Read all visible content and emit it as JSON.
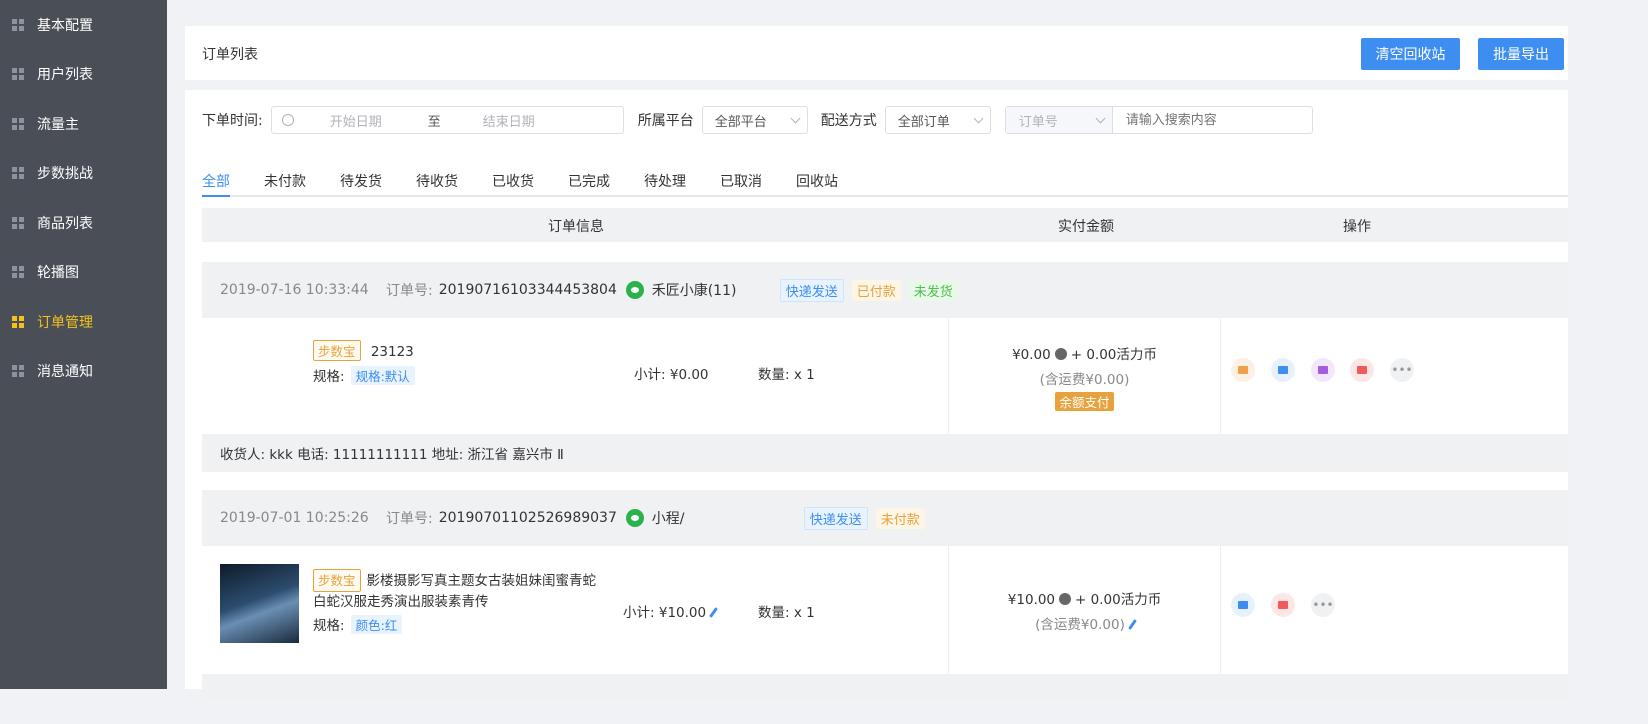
{
  "sidebar": {
    "items": [
      {
        "label": "基本配置",
        "active": false
      },
      {
        "label": "用户列表",
        "active": false
      },
      {
        "label": "流量主",
        "active": false
      },
      {
        "label": "步数挑战",
        "active": false
      },
      {
        "label": "商品列表",
        "active": false
      },
      {
        "label": "轮播图",
        "active": false
      },
      {
        "label": "订单管理",
        "active": true
      },
      {
        "label": "消息通知",
        "active": false
      }
    ]
  },
  "header": {
    "title": "订单列表",
    "clear_recycle_label": "清空回收站",
    "batch_export_label": "批量导出"
  },
  "filters": {
    "order_time_label": "下单时间:",
    "start_date_placeholder": "开始日期",
    "range_separator": "至",
    "end_date_placeholder": "结束日期",
    "platform_label": "所属平台",
    "platform_value": "全部平台",
    "delivery_label": "配送方式",
    "delivery_value": "全部订单",
    "search_field_value": "订单号",
    "search_placeholder": "请输入搜索内容"
  },
  "tabs": [
    {
      "label": "全部",
      "active": true
    },
    {
      "label": "未付款",
      "active": false
    },
    {
      "label": "待发货",
      "active": false
    },
    {
      "label": "待收货",
      "active": false
    },
    {
      "label": "已收货",
      "active": false
    },
    {
      "label": "已完成",
      "active": false
    },
    {
      "label": "待处理",
      "active": false
    },
    {
      "label": "已取消",
      "active": false
    },
    {
      "label": "回收站",
      "active": false
    }
  ],
  "table": {
    "col_order_info": "订单信息",
    "col_amount": "实付金额",
    "col_ops": "操作"
  },
  "orders": [
    {
      "datetime": "2019-07-16 10:33:44",
      "order_no_label": "订单号:",
      "order_no": "20190716103344453804",
      "shop": "禾匠小康(11)",
      "tags": [
        "快递发送",
        "已付款",
        "未发货"
      ],
      "product_badge": "步数宝",
      "product_name": "23123",
      "spec_label": "规格:",
      "spec_value": "规格:默认",
      "subtotal_label": "小计:",
      "subtotal": "¥0.00",
      "qty_label": "数量:",
      "qty": "x 1",
      "amount": "¥0.00",
      "amount_coins": "+ 0.00活力币",
      "shipping": "(含运费¥0.00)",
      "pay_method": "余额支付",
      "ops_icons": [
        "box-icon",
        "print-icon",
        "shirt-icon",
        "message-icon",
        "more-icon"
      ],
      "footer": "收货人: kkk 电话: 11111111111 地址: 浙江省 嘉兴市 Ⅱ"
    },
    {
      "datetime": "2019-07-01 10:25:26",
      "order_no_label": "订单号:",
      "order_no": "20190701102526989037",
      "shop": "小程/",
      "tags": [
        "快递发送",
        "未付款"
      ],
      "product_badge": "步数宝",
      "product_name_line1": "影楼摄影写真主题女古装姐妹闺蜜青蛇",
      "product_name_line2": "白蛇汉服走秀演出服装素青传",
      "spec_label": "规格:",
      "spec_value": "颜色:红",
      "subtotal_label": "小计:",
      "subtotal": "¥10.00",
      "qty_label": "数量:",
      "qty": "x 1",
      "amount": "¥10.00",
      "amount_coins": "+ 0.00活力币",
      "shipping": "(含运费¥0.00)",
      "ops_icons": [
        "print-icon",
        "message-icon",
        "more-icon"
      ]
    }
  ],
  "colors": {
    "sidebar_bg": "#4a4f57",
    "active_menu": "#f5c21b",
    "primary": "#3d8ef0",
    "pay_orange": "#e6a23c"
  }
}
